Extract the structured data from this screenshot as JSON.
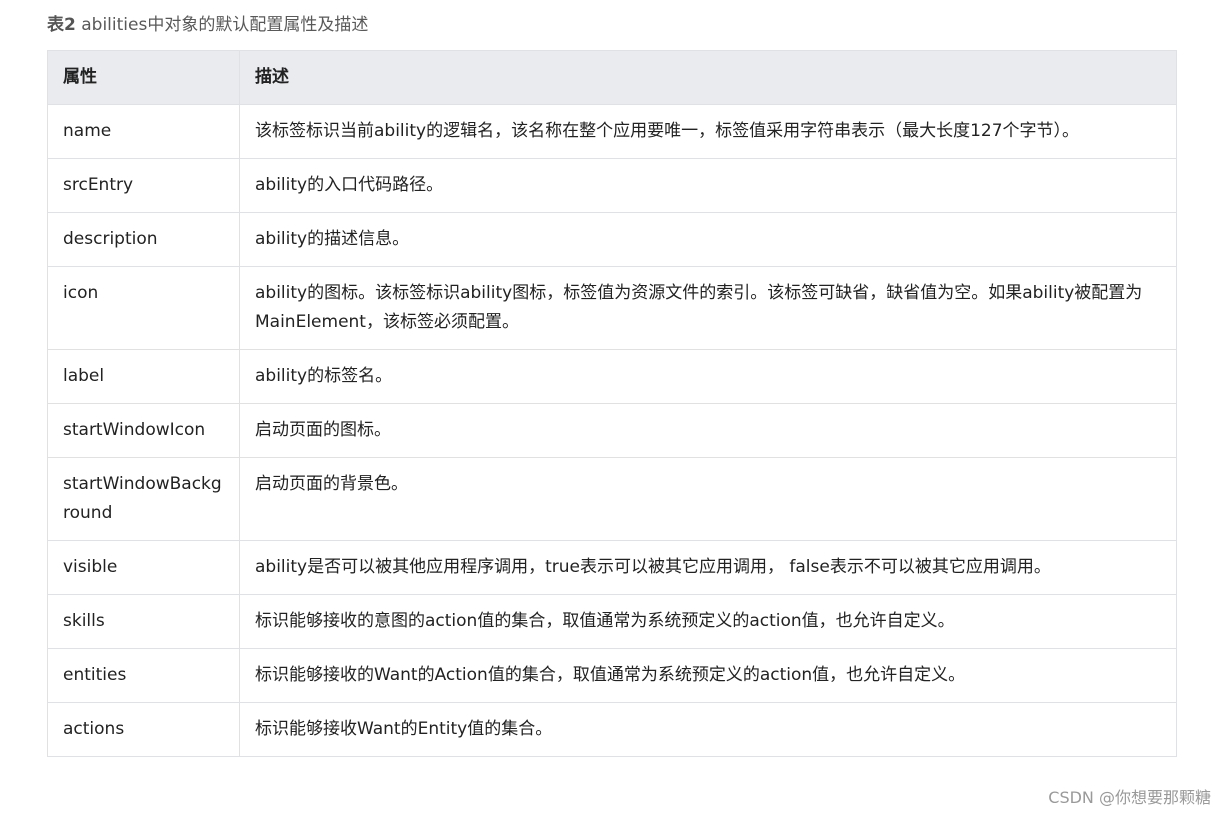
{
  "caption": {
    "label": "表2",
    "text": "abilities中对象的默认配置属性及描述"
  },
  "table": {
    "headers": [
      "属性",
      "描述"
    ],
    "rows": [
      {
        "name": "name",
        "desc": "该标签标识当前ability的逻辑名，该名称在整个应用要唯一，标签值采用字符串表示（最大长度127个字节）。"
      },
      {
        "name": "srcEntry",
        "desc": "ability的入口代码路径。"
      },
      {
        "name": "description",
        "desc": "ability的描述信息。"
      },
      {
        "name": "icon",
        "desc": "ability的图标。该标签标识ability图标，标签值为资源文件的索引。该标签可缺省，缺省值为空。如果ability被配置为MainElement，该标签必须配置。"
      },
      {
        "name": "label",
        "desc": "ability的标签名。"
      },
      {
        "name": "startWindowIcon",
        "desc": "启动页面的图标。"
      },
      {
        "name": "startWindowBackground",
        "desc": "启动页面的背景色。"
      },
      {
        "name": "visible",
        "desc": "ability是否可以被其他应用程序调用，true表示可以被其它应用调用， false表示不可以被其它应用调用。"
      },
      {
        "name": "skills",
        "desc": "标识能够接收的意图的action值的集合，取值通常为系统预定义的action值，也允许自定义。"
      },
      {
        "name": "entities",
        "desc": "标识能够接收的Want的Action值的集合，取值通常为系统预定义的action值，也允许自定义。"
      },
      {
        "name": "actions",
        "desc": "标识能够接收Want的Entity值的集合。"
      }
    ]
  },
  "watermark": "CSDN @你想要那颗糖"
}
